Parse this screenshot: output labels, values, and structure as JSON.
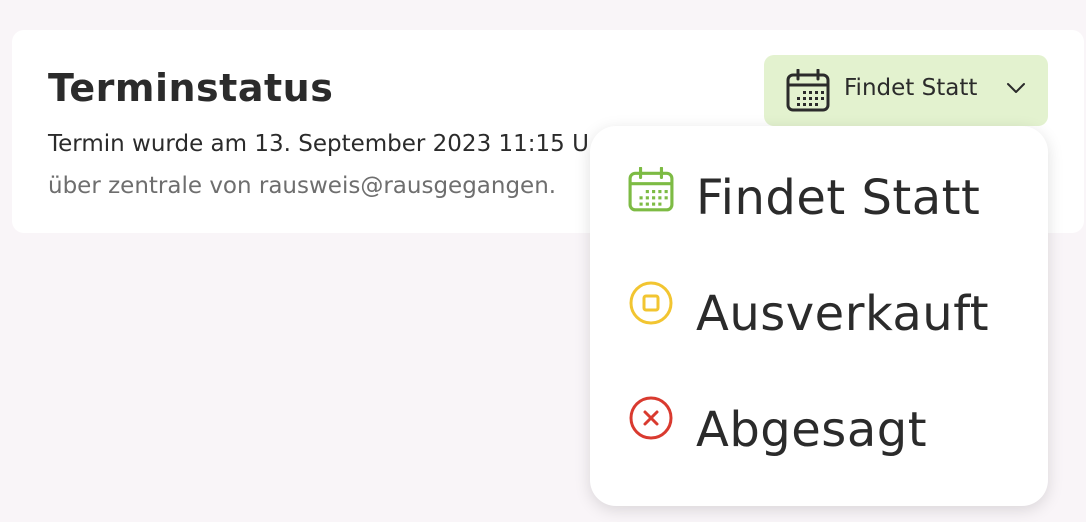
{
  "card": {
    "title": "Terminstatus",
    "line1": "Termin wurde am 13. September 2023 11:15 U",
    "line2": "über zentrale von rausweis@rausgegangen."
  },
  "status_button": {
    "label": "Findet Statt",
    "icon": "calendar-icon",
    "background": "#e3f2cf"
  },
  "menu": {
    "items": [
      {
        "label": "Findet Statt",
        "icon": "calendar-icon",
        "color": "#7dbb44"
      },
      {
        "label": "Ausverkauft",
        "icon": "stop-circle-icon",
        "color": "#f2c531"
      },
      {
        "label": "Abgesagt",
        "icon": "x-circle-icon",
        "color": "#d93a2f"
      }
    ]
  }
}
